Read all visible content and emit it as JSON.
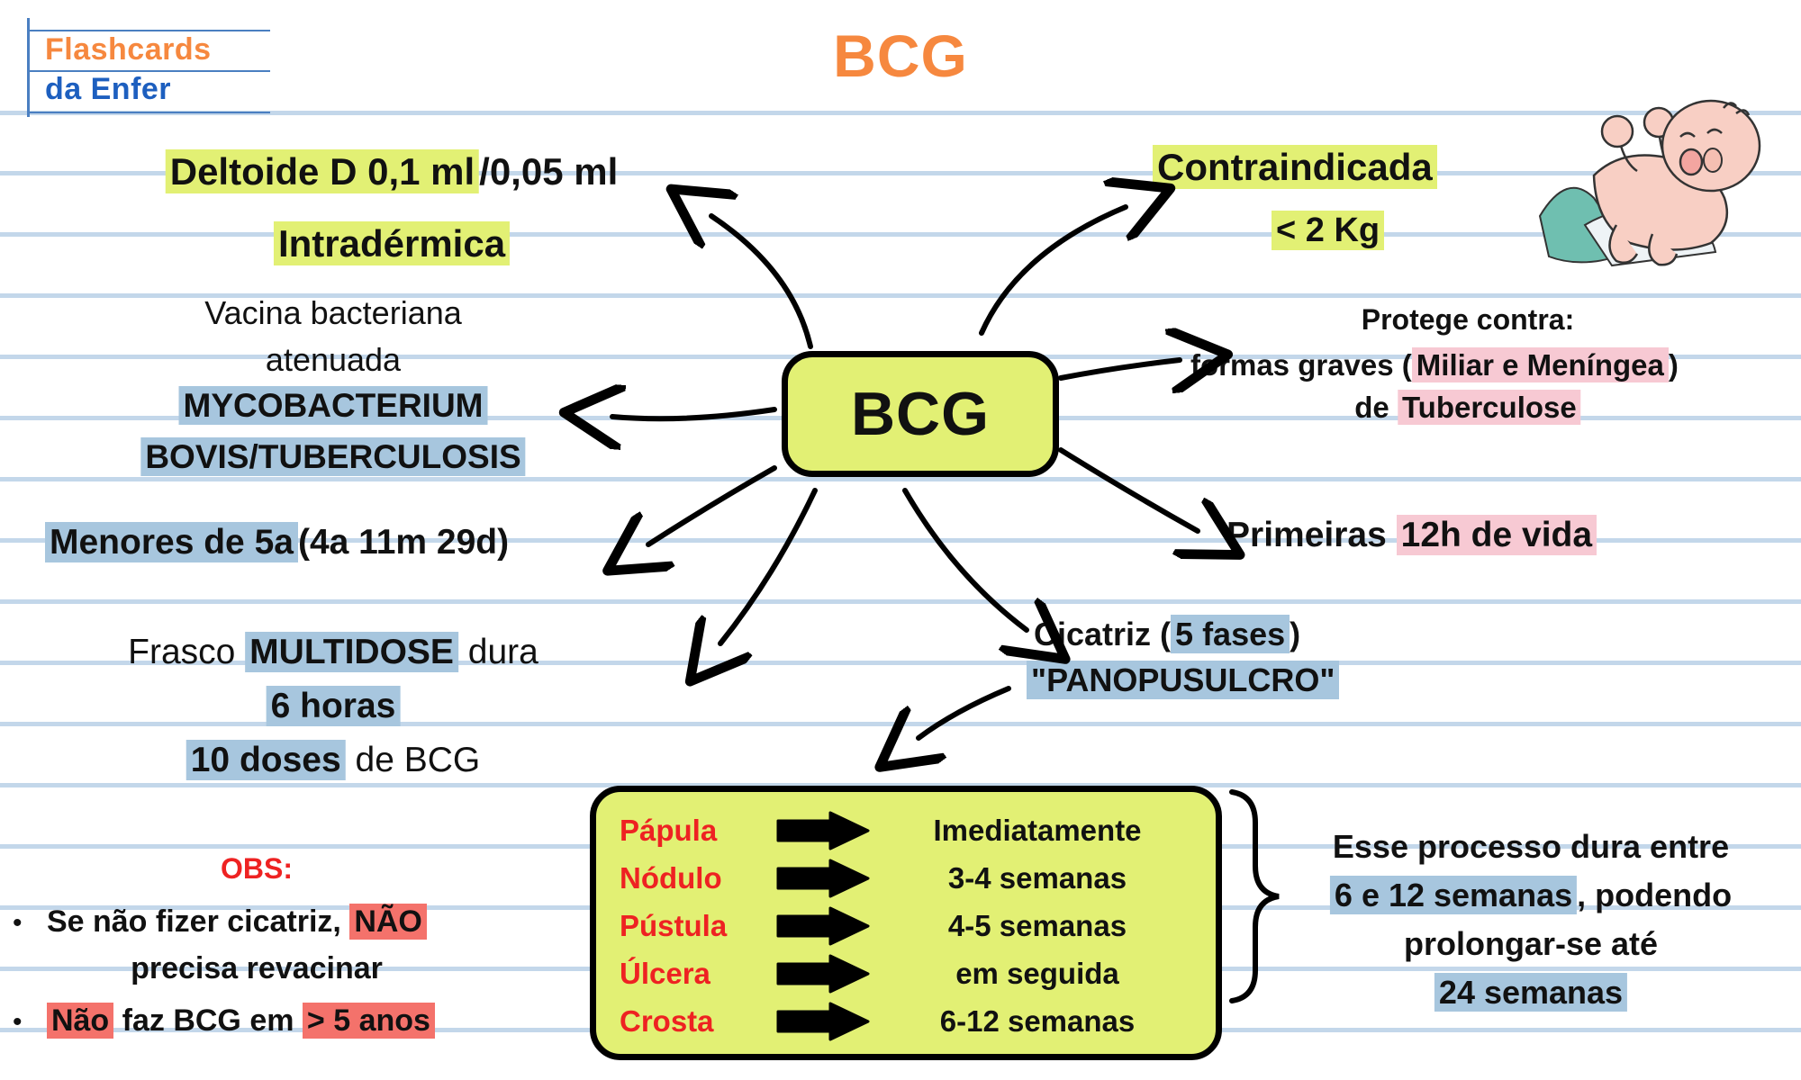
{
  "brand": {
    "line1": "Flashcards",
    "line2": "da Enfer",
    "color_orange": "#f6883f",
    "color_blue": "#1d5fbf"
  },
  "title": "BCG",
  "center_node": {
    "label": "BCG"
  },
  "colors": {
    "highlight_green": "#e2f074",
    "highlight_blue": "#a7c6de",
    "highlight_pink": "#f7c9d3",
    "highlight_red": "#f4726b",
    "rule_line": "#c3d7ea",
    "phase_red_text": "#ee2222"
  },
  "left": {
    "route_line1_hl": "Deltoide D 0,1 ml",
    "route_line1_plain": "/0,05 ml",
    "route_line2_hl": "Intradérmica",
    "vaccine_line1": "Vacina bacteriana",
    "vaccine_line2": "atenuada",
    "organism_line1": "MYCOBACTERIUM",
    "organism_line2": "BOVIS/TUBERCULOSIS",
    "age_hl": "Menores de 5a",
    "age_plain": "(4a 11m 29d)",
    "vial_pre": "Frasco ",
    "vial_hl": "MULTIDOSE",
    "vial_post": " dura",
    "vial_hours": "6 horas",
    "vial_doses_hl": "10 doses",
    "vial_doses_post": " de BCG"
  },
  "obs": {
    "heading": "OBS:",
    "bullet1_pre": "Se não fizer cicatriz, ",
    "bullet1_hl": "NÃO",
    "bullet1_line2": "precisa revacinar",
    "bullet2_hl1": "Não",
    "bullet2_mid": " faz BCG em ",
    "bullet2_hl2": "> 5 anos"
  },
  "right": {
    "contra_hl": "Contraindicada",
    "contra_weight_hl": "< 2 Kg",
    "protects_heading": "Protege contra:",
    "protects_line1_pre": "formas graves (",
    "protects_line1_hl": "Miliar e Meníngea",
    "protects_line1_post": ")",
    "protects_line2_pre": "de ",
    "protects_line2_hl": "Tuberculose",
    "timing_pre": "Primeiras ",
    "timing_hl": "12h de vida",
    "scar_pre": "Cicatriz (",
    "scar_hl": "5 fases",
    "scar_post": ")",
    "scar_mnemonic": "\"PANOPUSULCRO\"",
    "duration_line1": "Esse processo dura entre",
    "duration_line2_hl": "6 e 12 semanas",
    "duration_line2_post": ", podendo",
    "duration_line3": "prolongar-se até",
    "duration_line4_hl": "24 semanas"
  },
  "phases": {
    "rows": [
      {
        "name": "Pápula",
        "time": "Imediatamente"
      },
      {
        "name": "Nódulo",
        "time": "3-4 semanas"
      },
      {
        "name": "Pústula",
        "time": "4-5 semanas"
      },
      {
        "name": "Úlcera",
        "time": "em seguida"
      },
      {
        "name": "Crosta",
        "time": "6-12 semanas"
      }
    ]
  }
}
